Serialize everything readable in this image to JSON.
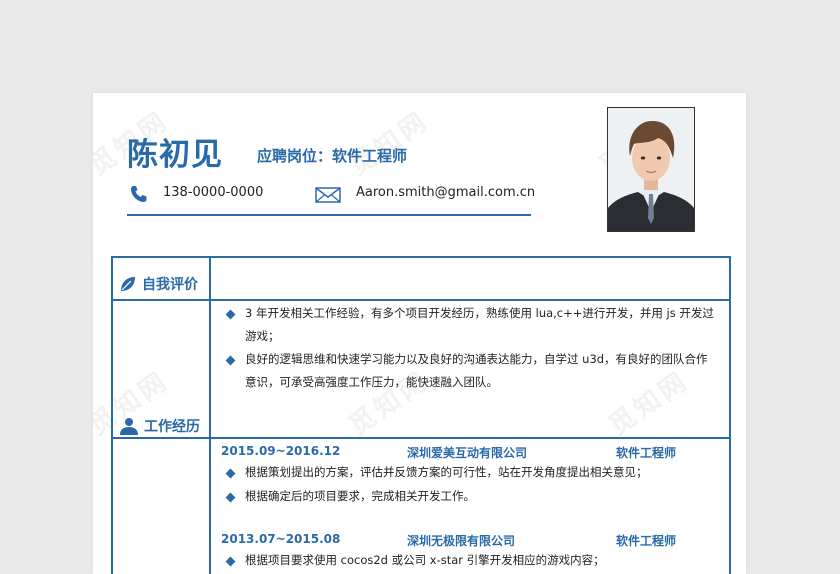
{
  "header": {
    "name": "陈初见",
    "job_title": "应聘岗位：软件工程师",
    "phone": "138-0000-0000",
    "email": "Aaron.smith@gmail.com.cn"
  },
  "self_eval": {
    "title": "自我评价",
    "items": [
      {
        "line1": "3 年开发相关工作经验，有多个项目开发经历，熟练使用 lua,c++进行开发，并用 js 开发过",
        "line2": "游戏；"
      },
      {
        "line1": "良好的逻辑思维和快速学习能力以及良好的沟通表达能力，自学过 u3d，有良好的团队合作",
        "line2": "意识，可承受高强度工作压力，能快速融入团队。"
      }
    ]
  },
  "work": {
    "title": "工作经历",
    "jobs": [
      {
        "period": "2015.09~2016.12",
        "company": "深圳爱美互动有限公司",
        "position": "软件工程师",
        "duties": [
          "根据策划提出的方案，评估并反馈方案的可行性，站在开发角度提出相关意见；",
          "根据确定后的项目要求，完成相关开发工作。"
        ]
      },
      {
        "period": "2013.07~2015.08",
        "company": "深圳无极限有限公司",
        "position": "软件工程师",
        "duties": [
          "根据项目要求使用 cocos2d 或公司 x-star 引擎开发相应的游戏内容；"
        ]
      }
    ]
  },
  "watermark": "觅知网",
  "colors": {
    "accent": "#2a6aa8"
  }
}
